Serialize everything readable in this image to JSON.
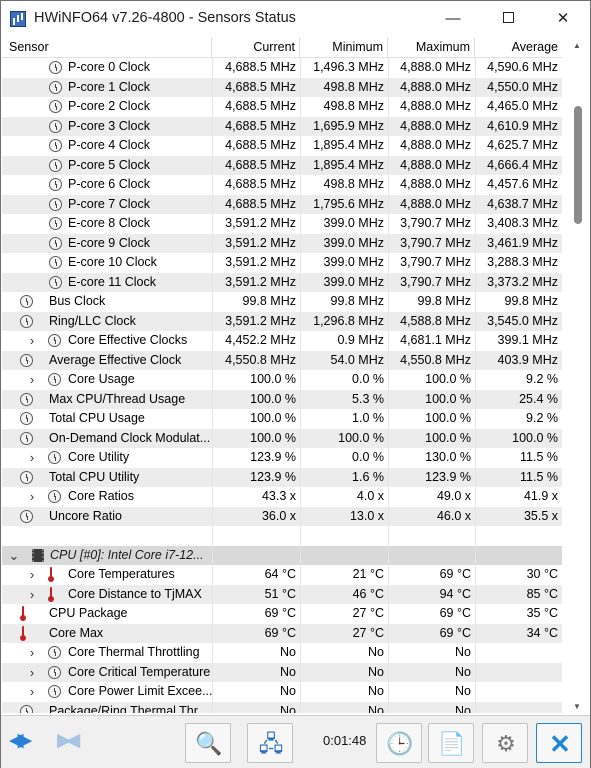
{
  "window": {
    "title": "HWiNFO64 v7.26-4800 - Sensors Status",
    "minimize_glyph": "—",
    "close_glyph": "✕"
  },
  "columns": {
    "sensor": "Sensor",
    "current": "Current",
    "minimum": "Minimum",
    "maximum": "Maximum",
    "average": "Average"
  },
  "rows": [
    {
      "icon": "clock-icon",
      "level": 2,
      "expand": false,
      "label": "P-core 0 Clock",
      "cur": "4,688.5 MHz",
      "min": "1,496.3 MHz",
      "max": "4,888.0 MHz",
      "avg": "4,590.6 MHz"
    },
    {
      "icon": "clock-icon",
      "level": 2,
      "expand": false,
      "label": "P-core 1 Clock",
      "cur": "4,688.5 MHz",
      "min": "498.8 MHz",
      "max": "4,888.0 MHz",
      "avg": "4,550.0 MHz"
    },
    {
      "icon": "clock-icon",
      "level": 2,
      "expand": false,
      "label": "P-core 2 Clock",
      "cur": "4,688.5 MHz",
      "min": "498.8 MHz",
      "max": "4,888.0 MHz",
      "avg": "4,465.0 MHz"
    },
    {
      "icon": "clock-icon",
      "level": 2,
      "expand": false,
      "label": "P-core 3 Clock",
      "cur": "4,688.5 MHz",
      "min": "1,695.9 MHz",
      "max": "4,888.0 MHz",
      "avg": "4,610.9 MHz"
    },
    {
      "icon": "clock-icon",
      "level": 2,
      "expand": false,
      "label": "P-core 4 Clock",
      "cur": "4,688.5 MHz",
      "min": "1,895.4 MHz",
      "max": "4,888.0 MHz",
      "avg": "4,625.7 MHz"
    },
    {
      "icon": "clock-icon",
      "level": 2,
      "expand": false,
      "label": "P-core 5 Clock",
      "cur": "4,688.5 MHz",
      "min": "1,895.4 MHz",
      "max": "4,888.0 MHz",
      "avg": "4,666.4 MHz"
    },
    {
      "icon": "clock-icon",
      "level": 2,
      "expand": false,
      "label": "P-core 6 Clock",
      "cur": "4,688.5 MHz",
      "min": "498.8 MHz",
      "max": "4,888.0 MHz",
      "avg": "4,457.6 MHz"
    },
    {
      "icon": "clock-icon",
      "level": 2,
      "expand": false,
      "label": "P-core 7 Clock",
      "cur": "4,688.5 MHz",
      "min": "1,795.6 MHz",
      "max": "4,888.0 MHz",
      "avg": "4,638.7 MHz"
    },
    {
      "icon": "clock-icon",
      "level": 2,
      "expand": false,
      "label": "E-core 8 Clock",
      "cur": "3,591.2 MHz",
      "min": "399.0 MHz",
      "max": "3,790.7 MHz",
      "avg": "3,408.3 MHz"
    },
    {
      "icon": "clock-icon",
      "level": 2,
      "expand": false,
      "label": "E-core 9 Clock",
      "cur": "3,591.2 MHz",
      "min": "399.0 MHz",
      "max": "3,790.7 MHz",
      "avg": "3,461.9 MHz"
    },
    {
      "icon": "clock-icon",
      "level": 2,
      "expand": false,
      "label": "E-core 10 Clock",
      "cur": "3,591.2 MHz",
      "min": "399.0 MHz",
      "max": "3,790.7 MHz",
      "avg": "3,288.3 MHz"
    },
    {
      "icon": "clock-icon",
      "level": 2,
      "expand": false,
      "label": "E-core 11 Clock",
      "cur": "3,591.2 MHz",
      "min": "399.0 MHz",
      "max": "3,790.7 MHz",
      "avg": "3,373.2 MHz"
    },
    {
      "icon": "clock-icon",
      "level": 1,
      "expand": false,
      "label": "Bus Clock",
      "cur": "99.8 MHz",
      "min": "99.8 MHz",
      "max": "99.8 MHz",
      "avg": "99.8 MHz"
    },
    {
      "icon": "clock-icon",
      "level": 1,
      "expand": false,
      "label": "Ring/LLC Clock",
      "cur": "3,591.2 MHz",
      "min": "1,296.8 MHz",
      "max": "4,588.8 MHz",
      "avg": "3,545.0 MHz"
    },
    {
      "icon": "clock-icon",
      "level": 1,
      "expand": true,
      "label": "Core Effective Clocks",
      "cur": "4,452.2 MHz",
      "min": "0.9 MHz",
      "max": "4,681.1 MHz",
      "avg": "399.1 MHz"
    },
    {
      "icon": "clock-icon",
      "level": 1,
      "expand": false,
      "label": "Average Effective Clock",
      "cur": "4,550.8 MHz",
      "min": "54.0 MHz",
      "max": "4,550.8 MHz",
      "avg": "403.9 MHz"
    },
    {
      "icon": "clock-icon",
      "level": 1,
      "expand": true,
      "label": "Core Usage",
      "cur": "100.0 %",
      "min": "0.0 %",
      "max": "100.0 %",
      "avg": "9.2 %"
    },
    {
      "icon": "clock-icon",
      "level": 1,
      "expand": false,
      "label": "Max CPU/Thread Usage",
      "cur": "100.0 %",
      "min": "5.3 %",
      "max": "100.0 %",
      "avg": "25.4 %"
    },
    {
      "icon": "clock-icon",
      "level": 1,
      "expand": false,
      "label": "Total CPU Usage",
      "cur": "100.0 %",
      "min": "1.0 %",
      "max": "100.0 %",
      "avg": "9.2 %"
    },
    {
      "icon": "clock-icon",
      "level": 1,
      "expand": false,
      "label": "On-Demand Clock Modulat...",
      "cur": "100.0 %",
      "min": "100.0 %",
      "max": "100.0 %",
      "avg": "100.0 %"
    },
    {
      "icon": "clock-icon",
      "level": 1,
      "expand": true,
      "label": "Core Utility",
      "cur": "123.9 %",
      "min": "0.0 %",
      "max": "130.0 %",
      "avg": "11.5 %"
    },
    {
      "icon": "clock-icon",
      "level": 1,
      "expand": false,
      "label": "Total CPU Utility",
      "cur": "123.9 %",
      "min": "1.6 %",
      "max": "123.9 %",
      "avg": "11.5 %"
    },
    {
      "icon": "clock-icon",
      "level": 1,
      "expand": true,
      "label": "Core Ratios",
      "cur": "43.3 x",
      "min": "4.0 x",
      "max": "49.0 x",
      "avg": "41.9 x"
    },
    {
      "icon": "clock-icon",
      "level": 1,
      "expand": false,
      "label": "Uncore Ratio",
      "cur": "36.0 x",
      "min": "13.0 x",
      "max": "46.0 x",
      "avg": "35.5 x"
    },
    {
      "icon": "",
      "level": 0,
      "expand": false,
      "label": "",
      "cur": "",
      "min": "",
      "max": "",
      "avg": ""
    },
    {
      "icon": "chip-icon",
      "level": 0,
      "expand": true,
      "section": true,
      "label": "CPU [#0]: Intel Core i7-12...",
      "cur": "",
      "min": "",
      "max": "",
      "avg": ""
    },
    {
      "icon": "thermometer-icon",
      "level": 1,
      "expand": true,
      "label": "Core Temperatures",
      "cur": "64 °C",
      "min": "21 °C",
      "max": "69 °C",
      "avg": "30 °C"
    },
    {
      "icon": "thermometer-icon",
      "level": 1,
      "expand": true,
      "label": "Core Distance to TjMAX",
      "cur": "51 °C",
      "min": "46 °C",
      "max": "94 °C",
      "avg": "85 °C"
    },
    {
      "icon": "thermometer-icon",
      "level": 1,
      "expand": false,
      "label": "CPU Package",
      "cur": "69 °C",
      "min": "27 °C",
      "max": "69 °C",
      "avg": "35 °C"
    },
    {
      "icon": "thermometer-icon",
      "level": 1,
      "expand": false,
      "label": "Core Max",
      "cur": "69 °C",
      "min": "27 °C",
      "max": "69 °C",
      "avg": "34 °C"
    },
    {
      "icon": "clock-icon",
      "level": 1,
      "expand": true,
      "label": "Core Thermal Throttling",
      "cur": "No",
      "min": "No",
      "max": "No",
      "avg": ""
    },
    {
      "icon": "clock-icon",
      "level": 1,
      "expand": true,
      "label": "Core Critical Temperature",
      "cur": "No",
      "min": "No",
      "max": "No",
      "avg": ""
    },
    {
      "icon": "clock-icon",
      "level": 1,
      "expand": true,
      "label": "Core Power Limit Excee...",
      "cur": "No",
      "min": "No",
      "max": "No",
      "avg": ""
    },
    {
      "icon": "clock-icon",
      "level": 1,
      "expand": false,
      "label": "Package/Ring Thermal Thr...",
      "cur": "No",
      "min": "No",
      "max": "No",
      "avg": ""
    }
  ],
  "toolbar": {
    "elapsed_time": "0:01:48",
    "nav_left_glyph": "◀▶",
    "nav_right_glyph": "▶◀"
  },
  "colors": {
    "accent": "#1e86d6",
    "temperature": "#c4201f"
  }
}
